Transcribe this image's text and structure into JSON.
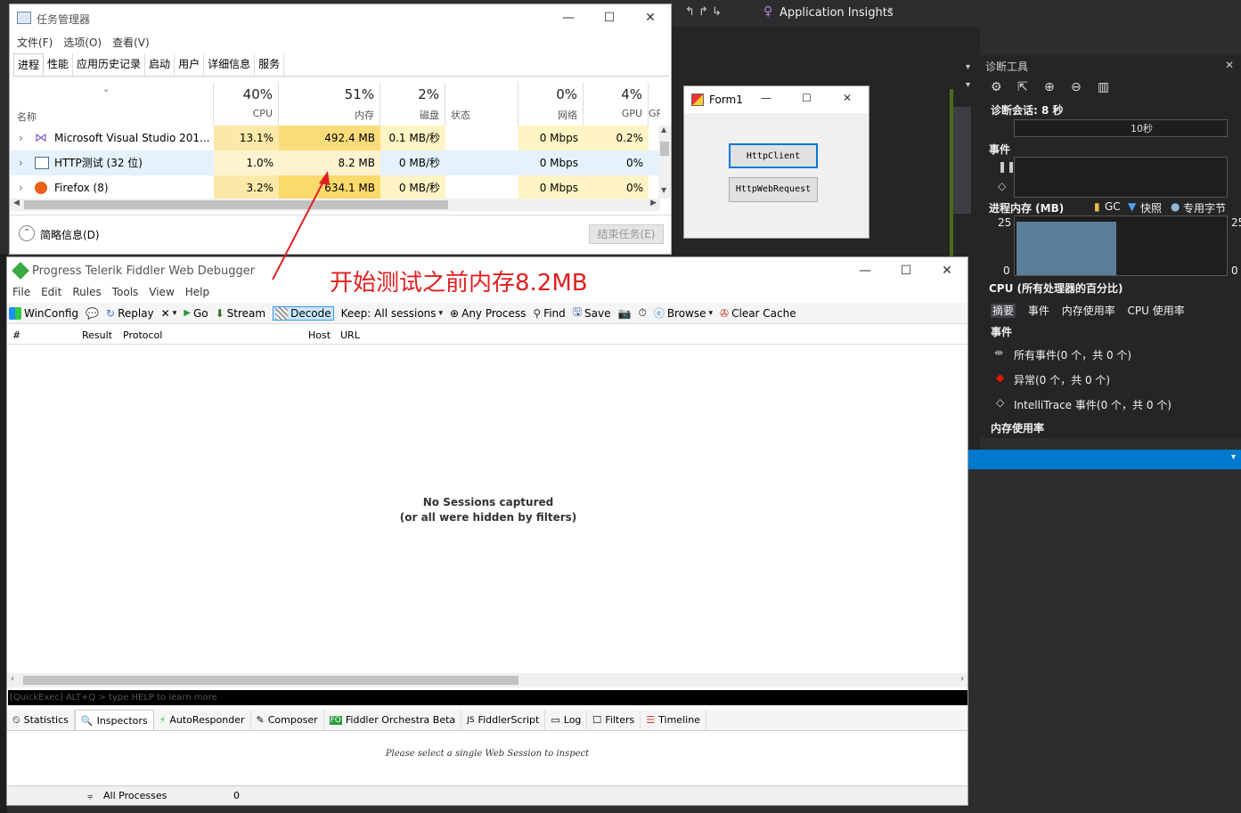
{
  "vs": {
    "app_insights": "Application Insights",
    "diag": {
      "title": "诊断工具",
      "session": "诊断会话: 8 秒",
      "tick_10s": "10秒",
      "events_header": "事件",
      "process_memory": "进程内存 (MB)",
      "legend_gc": "GC",
      "legend_snapshot": "快照",
      "legend_private": "专用字节",
      "mem_max_left": "25",
      "mem_min_left": "0",
      "mem_max_right": "25",
      "mem_min_right": "0",
      "cpu_header": "CPU (所有处理器的百分比)",
      "tabs": [
        "摘要",
        "事件",
        "内存使用率",
        "CPU 使用率"
      ],
      "events_section": "事件",
      "all_events": "所有事件(0 个，共 0 个)",
      "exceptions": "异常(0 个，共 0 个)",
      "intellitrace": "IntelliTrace 事件(0 个，共 0 个)",
      "memory_usage": "内存使用率"
    }
  },
  "taskmgr": {
    "title": "任务管理器",
    "menu": [
      "文件(F)",
      "选项(O)",
      "查看(V)"
    ],
    "tabs": [
      "进程",
      "性能",
      "应用历史记录",
      "启动",
      "用户",
      "详细信息",
      "服务"
    ],
    "col_name": "名称",
    "columns": [
      {
        "pct": "40%",
        "label": "CPU"
      },
      {
        "pct": "51%",
        "label": "内存"
      },
      {
        "pct": "2%",
        "label": "磁盘"
      },
      {
        "pct": "",
        "label": "状态"
      },
      {
        "pct": "0%",
        "label": "网络"
      },
      {
        "pct": "4%",
        "label": "GPU"
      },
      {
        "pct": "",
        "label": "GPU"
      }
    ],
    "rows": [
      {
        "name": "Microsoft Visual Studio 201...",
        "cpu": "13.1%",
        "mem": "492.4 MB",
        "disk": "0.1 MB/秒",
        "net": "0 Mbps",
        "gpu": "0.2%"
      },
      {
        "name": "HTTP测试 (32 位)",
        "cpu": "1.0%",
        "mem": "8.2 MB",
        "disk": "0 MB/秒",
        "net": "0 Mbps",
        "gpu": "0%"
      },
      {
        "name": "Firefox (8)",
        "cpu": "3.2%",
        "mem": "634.1 MB",
        "disk": "0 MB/秒",
        "net": "0 Mbps",
        "gpu": "0%"
      }
    ],
    "brief": "简略信息(D)",
    "end_task": "结束任务(E)"
  },
  "form1": {
    "title": "Form1",
    "btn_httpclient": "HttpClient",
    "btn_httpwebrequest": "HttpWebRequest"
  },
  "fiddler": {
    "title": "Progress Telerik Fiddler Web Debugger",
    "menu": [
      "File",
      "Edit",
      "Rules",
      "Tools",
      "View",
      "Help"
    ],
    "toolbar": {
      "winconfig": "WinConfig",
      "replay": "Replay",
      "go": "Go",
      "stream": "Stream",
      "decode": "Decode",
      "keep": "Keep: All sessions",
      "any_process": "Any Process",
      "find": "Find",
      "save": "Save",
      "browse": "Browse",
      "clear_cache": "Clear Cache"
    },
    "grid_cols": [
      "#",
      "Result",
      "Protocol",
      "Host",
      "URL"
    ],
    "no_sessions_1": "No Sessions captured",
    "no_sessions_2": "(or all were hidden by filters)",
    "quickexec": "[QuickExec] ALT+Q > type HELP to learn more",
    "tabs": [
      "Statistics",
      "Inspectors",
      "AutoResponder",
      "Composer",
      "Fiddler Orchestra Beta",
      "FiddlerScript",
      "Log",
      "Filters",
      "Timeline"
    ],
    "inspect_msg": "Please select a single Web Session to inspect",
    "status_processes": "All Processes",
    "status_count": "0"
  },
  "annotation": "开始测试之前内存8.2MB"
}
